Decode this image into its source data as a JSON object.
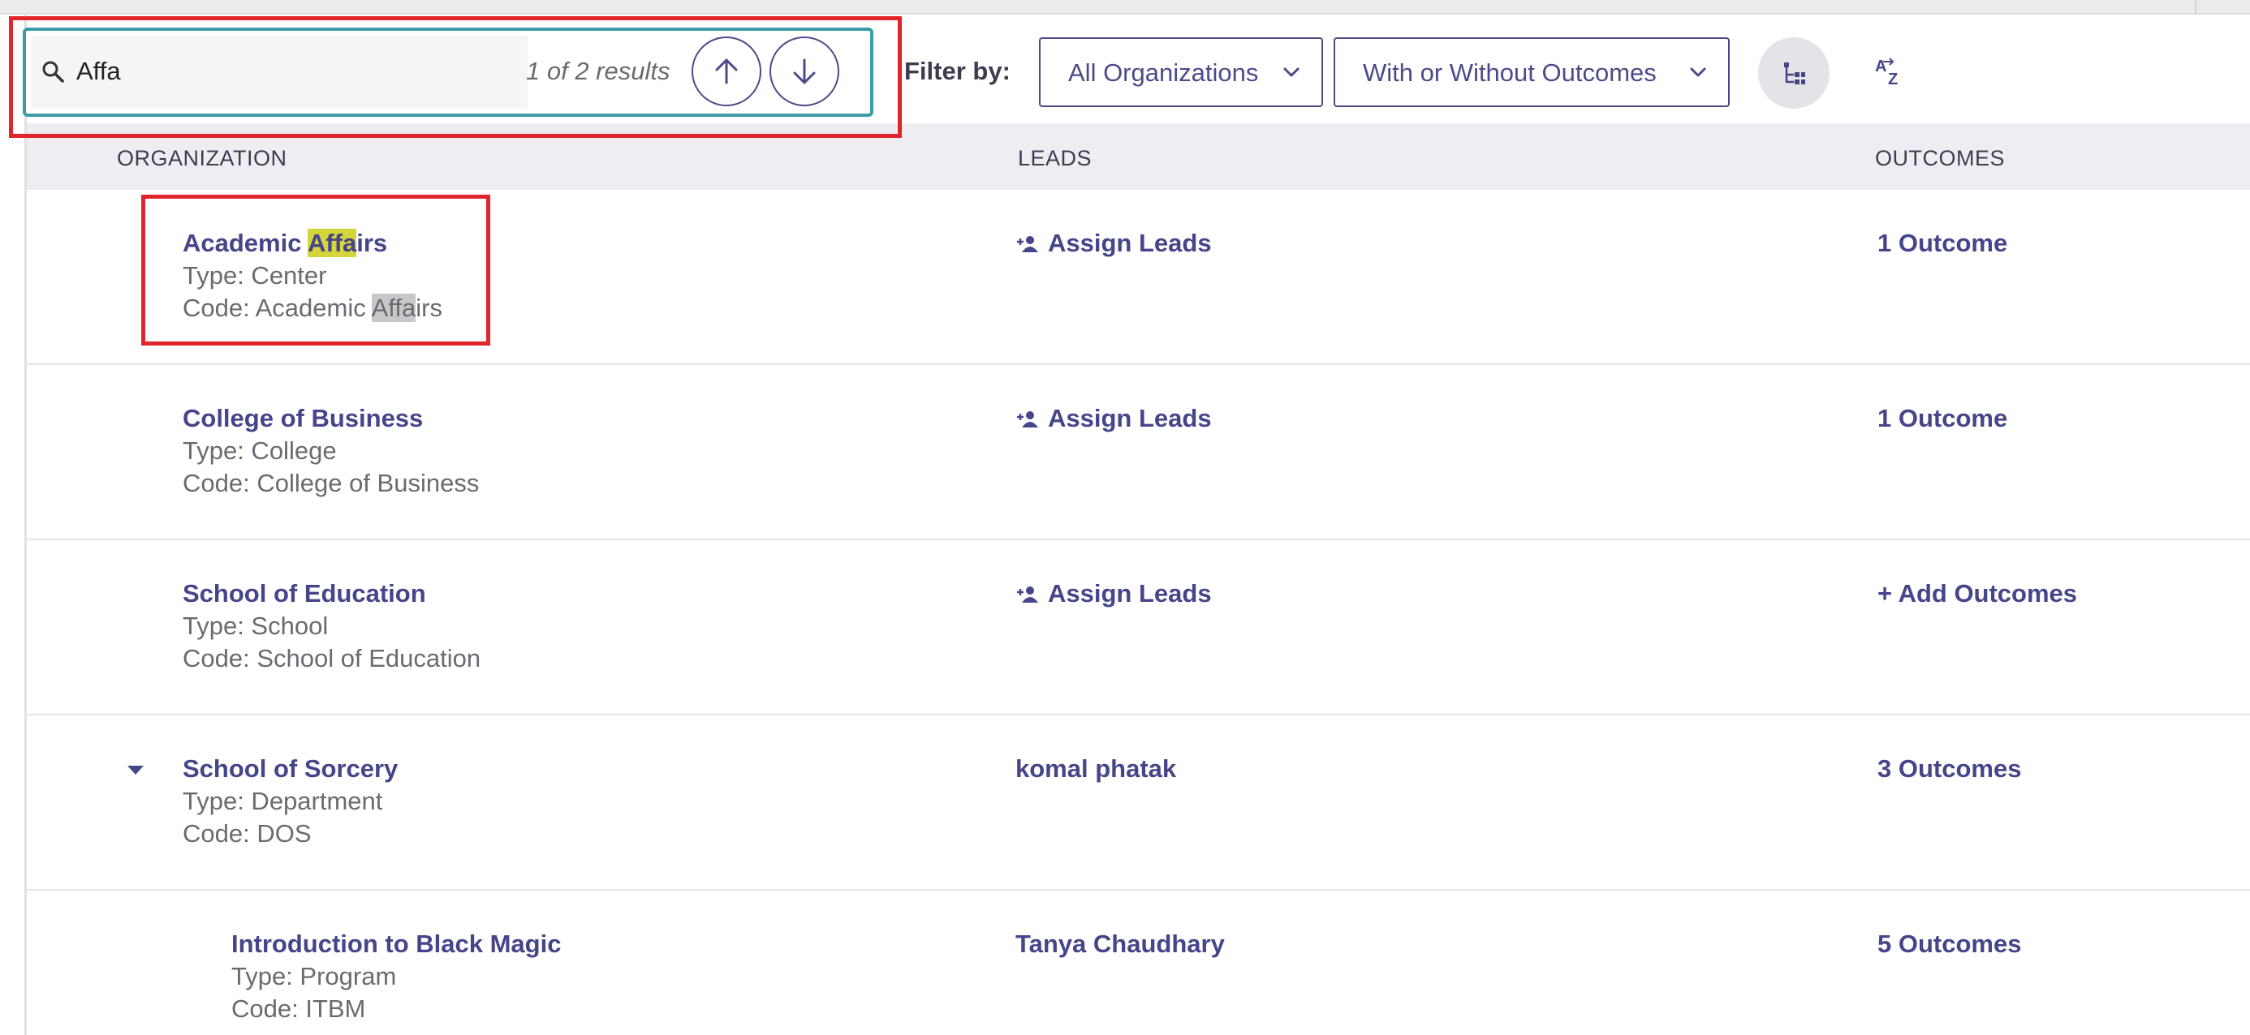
{
  "search": {
    "value": "Affa",
    "result_count": "1 of 2 results"
  },
  "filters": {
    "label": "Filter by:",
    "organization": "All Organizations",
    "outcomes": "With or Without Outcomes"
  },
  "table": {
    "headers": {
      "organization": "ORGANIZATION",
      "leads": "LEADS",
      "outcomes": "OUTCOMES"
    },
    "rows": [
      {
        "name_pre": "Academic ",
        "name_hl": "Affa",
        "name_post": "irs",
        "type": "Type: Center",
        "code_pre": "Code: Academic ",
        "code_hl": "Affa",
        "code_post": "irs",
        "lead": "Assign Leads",
        "outcome": "1 Outcome"
      },
      {
        "name": "College of Business",
        "type": "Type: College",
        "code": "Code: College of Business",
        "lead": "Assign Leads",
        "outcome": "1 Outcome"
      },
      {
        "name": "School of Education",
        "type": "Type: School",
        "code": "Code: School of Education",
        "lead": "Assign Leads",
        "outcome": "+ Add Outcomes"
      },
      {
        "name": "School of Sorcery",
        "type": "Type: Department",
        "code": "Code: DOS",
        "lead": "komal phatak",
        "outcome": "3 Outcomes"
      },
      {
        "name": "Introduction to Black Magic",
        "type": "Type: Program",
        "code": "Code: ITBM",
        "lead": "Tanya Chaudhary",
        "outcome": "5 Outcomes"
      }
    ]
  },
  "icons": {
    "search": "search-icon",
    "prev": "arrow-up-icon",
    "next": "arrow-down-icon",
    "chevron": "chevron-down-icon",
    "hierarchy": "hierarchy-view-icon",
    "sort": "sort-az-icon",
    "assign": "person-add-icon",
    "collapse": "caret-down-icon"
  },
  "colors": {
    "accent": "#45458a",
    "search_border": "#3a9ca5",
    "annotation": "#e0252b",
    "highlight_active": "#d4d53b",
    "highlight_inactive": "#c8c8c8"
  }
}
